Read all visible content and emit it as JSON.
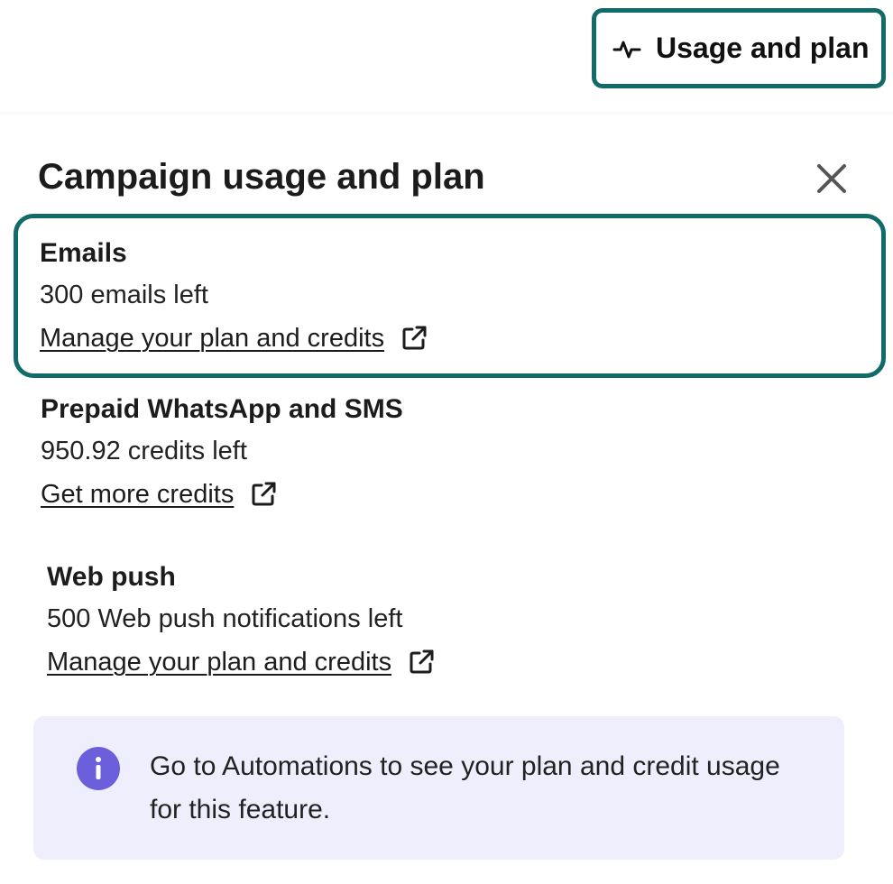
{
  "header_button": {
    "label": "Usage and plan",
    "icon": "activity-pulse-icon"
  },
  "panel": {
    "title": "Campaign usage and plan",
    "close_icon": "close-icon",
    "accent_color": "#126b68"
  },
  "sections": [
    {
      "heading": "Emails",
      "value": "300 emails left",
      "link": "Manage your plan and credits",
      "link_icon": "external-link-icon",
      "highlighted": true
    },
    {
      "heading": "Prepaid WhatsApp and SMS",
      "value": "950.92 credits left",
      "link": "Get more credits",
      "link_icon": "external-link-icon",
      "highlighted": false
    },
    {
      "heading": "Web push",
      "value": "500 Web push notifications left",
      "link": "Manage your plan and credits",
      "link_icon": "external-link-icon",
      "highlighted": false
    }
  ],
  "info": {
    "icon": "info-icon",
    "text": "Go to Automations to see your plan and credit usage for this feature.",
    "icon_color": "#6b5fdc",
    "background": "#eeeefc"
  }
}
